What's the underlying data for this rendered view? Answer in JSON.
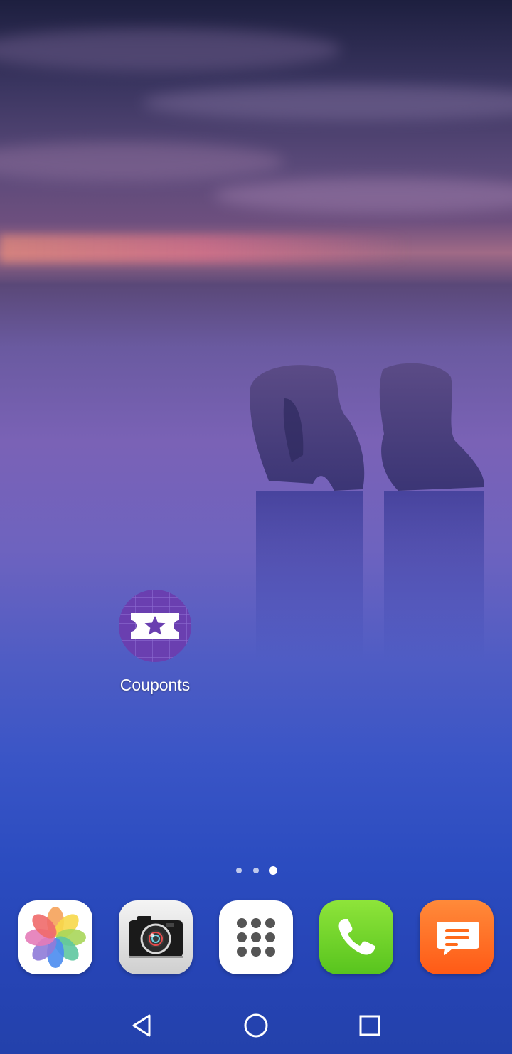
{
  "home": {
    "apps": [
      {
        "label": "Couponts",
        "icon": "coupon-ticket-star-icon"
      }
    ]
  },
  "page_indicator": {
    "pages": 3,
    "current": 3
  },
  "dock": {
    "apps": [
      {
        "icon": "photos-pinwheel-icon"
      },
      {
        "icon": "camera-icon"
      },
      {
        "icon": "app-drawer-grid-icon"
      },
      {
        "icon": "phone-handset-icon"
      },
      {
        "icon": "messages-bubble-icon"
      }
    ]
  },
  "navbar": {
    "buttons": [
      {
        "icon": "back-triangle-icon"
      },
      {
        "icon": "home-circle-icon"
      },
      {
        "icon": "recents-square-icon"
      }
    ]
  },
  "colors": {
    "coupon_purple": "#6a3fb0",
    "phone_green": "#6fd42a",
    "messages_orange": "#ff6a1a"
  }
}
